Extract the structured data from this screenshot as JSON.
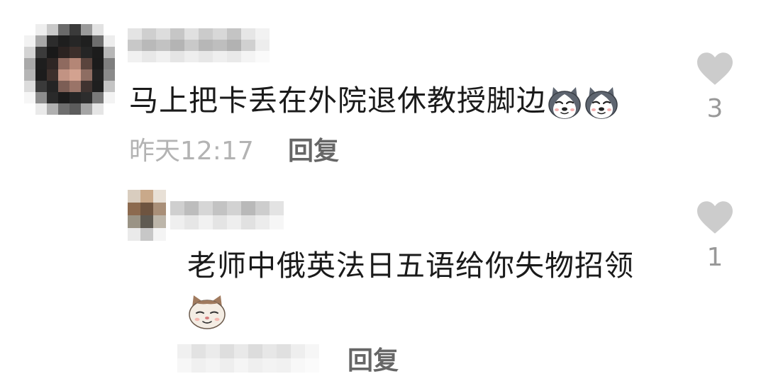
{
  "colors": {
    "text": "#1a1a1a",
    "meta": "#b3b3b3",
    "reply_button": "#666666",
    "like_icon": "#cccccc",
    "like_count": "#999999"
  },
  "comment": {
    "avatar": "pixelated-avatar",
    "text": "马上把卡丢在外院退休教授脚边",
    "emojis": [
      "husky-dog-emoji",
      "husky-dog-emoji"
    ],
    "time": "昨天12:17",
    "reply_label": "回复",
    "like_count": "3",
    "like_icon": "heart-icon"
  },
  "reply": {
    "avatar": "pixelated-avatar",
    "text": "老师中俄英法日五语给你失物招领",
    "emojis": [
      "cat-face-emoji"
    ],
    "reply_label": "回复",
    "like_count": "1",
    "like_icon": "heart-icon"
  }
}
